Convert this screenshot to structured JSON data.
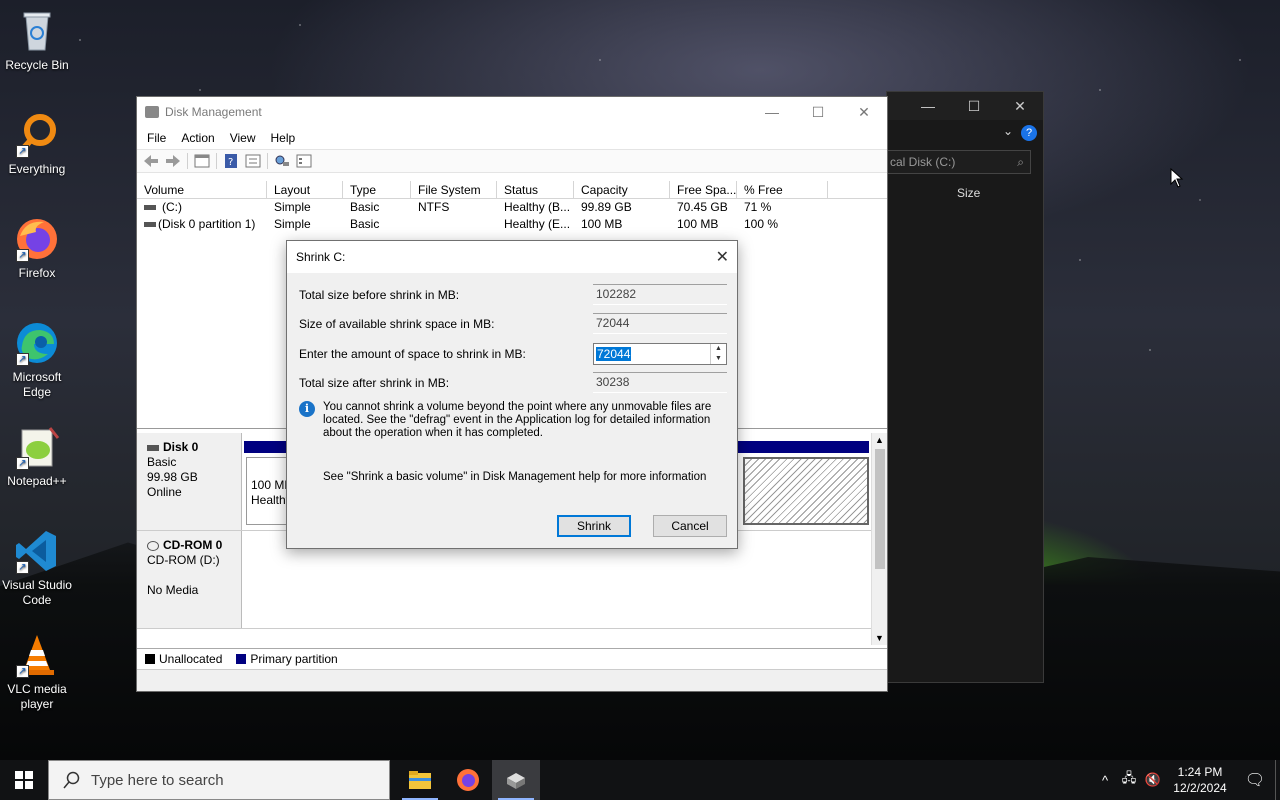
{
  "desktop": {
    "icons": [
      {
        "label": "Recycle Bin"
      },
      {
        "label": "Everything"
      },
      {
        "label": "Firefox"
      },
      {
        "label": "Microsoft Edge"
      },
      {
        "label": "Notepad++"
      },
      {
        "label": "Visual Studio Code"
      },
      {
        "label": "VLC media player"
      }
    ]
  },
  "bg_window": {
    "address_partial": "cal Disk (C:)",
    "column_size": "Size",
    "help_glyph": "?"
  },
  "disk_mgmt": {
    "title": "Disk Management",
    "menu": [
      "File",
      "Action",
      "View",
      "Help"
    ],
    "columns": [
      "Volume",
      "Layout",
      "Type",
      "File System",
      "Status",
      "Capacity",
      "Free Spa...",
      "% Free"
    ],
    "rows": [
      {
        "volume": "(C:)",
        "layout": "Simple",
        "type": "Basic",
        "fs": "NTFS",
        "status": "Healthy (B...",
        "capacity": "99.89 GB",
        "free": "70.45 GB",
        "pct": "71 %"
      },
      {
        "volume": "(Disk 0 partition 1)",
        "layout": "Simple",
        "type": "Basic",
        "fs": "",
        "status": "Healthy (E...",
        "capacity": "100 MB",
        "free": "100 MB",
        "pct": "100 %"
      }
    ],
    "disk0": {
      "name": "Disk 0",
      "type": "Basic",
      "size": "99.98 GB",
      "state": "Online",
      "part_size": "100 MB",
      "part_status": "Healthy"
    },
    "cdrom0": {
      "name": "CD-ROM 0",
      "drive": "CD-ROM (D:)",
      "media": "No Media"
    },
    "legend": {
      "unallocated": "Unallocated",
      "primary": "Primary partition"
    },
    "colors": {
      "primary": "#000080",
      "unallocated": "#000000"
    }
  },
  "dialog": {
    "title": "Shrink C:",
    "rows": [
      {
        "label": "Total size before shrink in MB:",
        "value": "102282"
      },
      {
        "label": "Size of available shrink space in MB:",
        "value": "72044"
      },
      {
        "label": "Enter the amount of space to shrink in MB:",
        "value": "72044"
      },
      {
        "label": "Total size after shrink in MB:",
        "value": "30238"
      }
    ],
    "info": "You cannot shrink a volume beyond the point where any unmovable files are located. See the \"defrag\" event in the Application log for detailed information about the operation when it has completed.",
    "help": "See \"Shrink a basic volume\" in Disk Management help for more information",
    "shrink_label": "Shrink",
    "cancel_label": "Cancel"
  },
  "taskbar": {
    "search_placeholder": "Type here to search",
    "time": "1:24 PM",
    "date": "12/2/2024"
  }
}
